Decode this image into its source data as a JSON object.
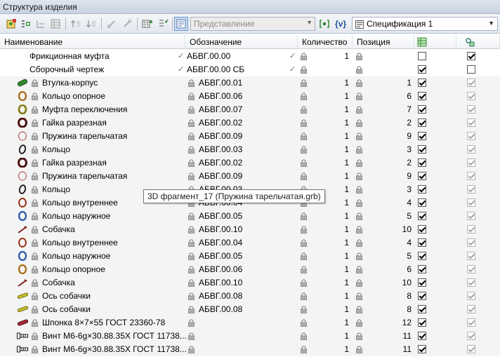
{
  "panel": {
    "title": "Структура изделия"
  },
  "toolbar": {
    "view_label": "Представление",
    "variables_label": "{v}",
    "spec_label": "Спецификация 1"
  },
  "columns": {
    "name": "Наименование",
    "designation": "Обозначение",
    "quantity": "Количество",
    "position": "Позиция"
  },
  "rows": [
    {
      "icon": "none",
      "name": "Фрикционная муфта",
      "designation": "АБВГ.00.00",
      "quantity": "1",
      "position": "",
      "in_spec": false,
      "col2": true,
      "doc": true
    },
    {
      "icon": "none",
      "name": "Сборочный чертеж",
      "designation": "АБВГ.00.00 СБ",
      "quantity": "",
      "position": "",
      "in_spec": true,
      "col2": false,
      "doc": true
    },
    {
      "icon": "bushing",
      "name": "Втулка-корпус",
      "designation": "АБВГ.00.01",
      "quantity": "1",
      "position": "1",
      "in_spec": true,
      "col2": true
    },
    {
      "icon": "ring-orange",
      "name": "Кольцо опорное",
      "designation": "АБВГ.00.06",
      "quantity": "1",
      "position": "6",
      "in_spec": true,
      "col2": true
    },
    {
      "icon": "ring-olive",
      "name": "Муфта переключения",
      "designation": "АБВГ.00.07",
      "quantity": "1",
      "position": "7",
      "in_spec": true,
      "col2": true
    },
    {
      "icon": "nut",
      "name": "Гайка разрезная",
      "designation": "АБВГ.00.02",
      "quantity": "1",
      "position": "2",
      "in_spec": true,
      "col2": true
    },
    {
      "icon": "spring",
      "name": "Пружина тарельчатая",
      "designation": "АБВГ.00.09",
      "quantity": "1",
      "position": "9",
      "in_spec": true,
      "col2": true
    },
    {
      "icon": "ring-black",
      "name": "Кольцо",
      "designation": "АБВГ.00.03",
      "quantity": "1",
      "position": "3",
      "in_spec": true,
      "col2": true
    },
    {
      "icon": "nut",
      "name": "Гайка разрезная",
      "designation": "АБВГ.00.02",
      "quantity": "1",
      "position": "2",
      "in_spec": true,
      "col2": true
    },
    {
      "icon": "spring",
      "name": "Пружина тарельчатая",
      "designation": "АБВГ.00.09",
      "quantity": "1",
      "position": "9",
      "in_spec": true,
      "col2": true
    },
    {
      "icon": "ring-black",
      "name": "Кольцо",
      "designation": "АБВГ.00.03",
      "quantity": "1",
      "position": "3",
      "in_spec": true,
      "col2": true
    },
    {
      "icon": "ring-red",
      "name": "Кольцо внутреннее",
      "designation": "АБВГ.00.04",
      "quantity": "1",
      "position": "4",
      "in_spec": true,
      "col2": true
    },
    {
      "icon": "ring-blue",
      "name": "Кольцо наружное",
      "designation": "АБВГ.00.05",
      "quantity": "1",
      "position": "5",
      "in_spec": true,
      "col2": true
    },
    {
      "icon": "pawl",
      "name": "Собачка",
      "designation": "АБВГ.00.10",
      "quantity": "1",
      "position": "10",
      "in_spec": true,
      "col2": true
    },
    {
      "icon": "ring-red",
      "name": "Кольцо внутреннее",
      "designation": "АБВГ.00.04",
      "quantity": "1",
      "position": "4",
      "in_spec": true,
      "col2": true
    },
    {
      "icon": "ring-blue",
      "name": "Кольцо наружное",
      "designation": "АБВГ.00.05",
      "quantity": "1",
      "position": "5",
      "in_spec": true,
      "col2": true
    },
    {
      "icon": "ring-orange",
      "name": "Кольцо опорное",
      "designation": "АБВГ.00.06",
      "quantity": "1",
      "position": "6",
      "in_spec": true,
      "col2": true
    },
    {
      "icon": "pawl",
      "name": "Собачка",
      "designation": "АБВГ.00.10",
      "quantity": "1",
      "position": "10",
      "in_spec": true,
      "col2": true
    },
    {
      "icon": "pin",
      "name": "Ось собачки",
      "designation": "АБВГ.00.08",
      "quantity": "1",
      "position": "8",
      "in_spec": true,
      "col2": true
    },
    {
      "icon": "pin",
      "name": "Ось собачки",
      "designation": "АБВГ.00.08",
      "quantity": "1",
      "position": "8",
      "in_spec": true,
      "col2": true
    },
    {
      "icon": "key",
      "name": "Шпонка 8×7×55 ГОСТ 23360-78",
      "designation": "",
      "quantity": "1",
      "position": "12",
      "in_spec": true,
      "col2": true
    },
    {
      "icon": "bolt",
      "name": "Винт М6-6g×30.88.35Х ГОСТ 11738...",
      "designation": "",
      "quantity": "1",
      "position": "11",
      "in_spec": true,
      "col2": true
    },
    {
      "icon": "bolt",
      "name": "Винт М6-6g×30.88.35Х ГОСТ 11738...",
      "designation": "",
      "quantity": "1",
      "position": "11",
      "in_spec": true,
      "col2": true
    }
  ],
  "tooltip": {
    "text": "3D фрагмент_17 (Пружина тарельчатая.grb)"
  }
}
